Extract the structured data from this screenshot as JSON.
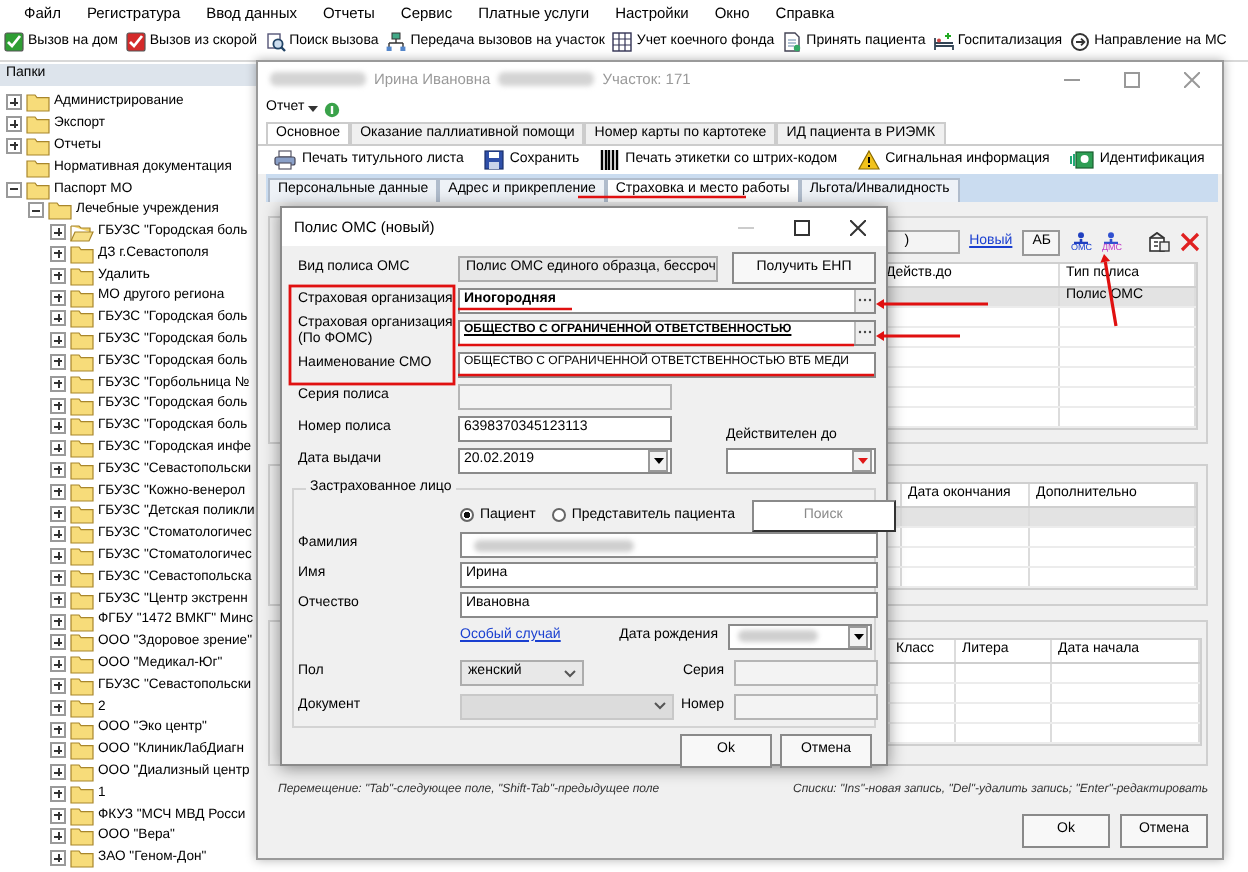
{
  "menu": [
    "Файл",
    "Регистратура",
    "Ввод данных",
    "Отчеты",
    "Сервис",
    "Платные услуги",
    "Настройки",
    "Окно",
    "Справка"
  ],
  "toolbar": [
    "Вызов на дом",
    "Вызов из скорой",
    "Поиск вызова",
    "Передача вызовов на участок",
    "Учет коечного фонда",
    "Принять пациента",
    "Госпитализация",
    "Направление на МС"
  ],
  "folders": {
    "title": "Папки",
    "tree": [
      {
        "label": "Администрирование",
        "expanded": false,
        "selected": false
      },
      {
        "label": "Экспорт",
        "expanded": false,
        "selected": false
      },
      {
        "label": "Отчеты",
        "expanded": false,
        "selected": false
      },
      {
        "label": "Нормативная документация",
        "selected": false
      },
      {
        "label": "Паспорт МО",
        "expanded": true,
        "selected": false,
        "children": [
          {
            "label": "Лечебные учреждения",
            "expanded": true,
            "selected": false,
            "children": [
              {
                "label": "ГБУЗС \"Городская боль",
                "expanded": false,
                "selected": true
              },
              {
                "label": "ДЗ г.Севастополя",
                "expanded": false,
                "selected": false
              },
              {
                "label": "Удалить",
                "expanded": false,
                "selected": false
              },
              {
                "label": "МО другого региона",
                "expanded": false,
                "selected": false
              },
              {
                "label": "ГБУЗС \"Городская боль",
                "expanded": false,
                "selected": false
              },
              {
                "label": "ГБУЗС \"Городская боль",
                "expanded": false,
                "selected": false
              },
              {
                "label": "ГБУЗС \"Городская боль",
                "expanded": false,
                "selected": false
              },
              {
                "label": "ГБУЗС \"Горбольница №",
                "expanded": false,
                "selected": false
              },
              {
                "label": "ГБУЗС \"Городская боль",
                "expanded": false,
                "selected": false
              },
              {
                "label": "ГБУЗС \"Городская боль",
                "expanded": false,
                "selected": false
              },
              {
                "label": "ГБУЗС \"Городская инфе",
                "expanded": false,
                "selected": false
              },
              {
                "label": "ГБУЗС \"Севастопольски",
                "expanded": false,
                "selected": false
              },
              {
                "label": "ГБУЗС \"Кожно-венерол",
                "expanded": false,
                "selected": false
              },
              {
                "label": "ГБУЗС \"Детская поликли",
                "expanded": false,
                "selected": false
              },
              {
                "label": "ГБУЗС \"Стоматологичес",
                "expanded": false,
                "selected": false
              },
              {
                "label": "ГБУЗС \"Стоматологичес",
                "expanded": false,
                "selected": false
              },
              {
                "label": "ГБУЗС \"Севастопольска",
                "expanded": false,
                "selected": false
              },
              {
                "label": "ГБУЗС \"Центр экстренн",
                "expanded": false,
                "selected": false
              },
              {
                "label": "ФГБУ \"1472 ВМКГ\" Минс",
                "expanded": false,
                "selected": false
              },
              {
                "label": "ООО \"Здоровое зрение\"",
                "expanded": false,
                "selected": false
              },
              {
                "label": "ООО \"Медикал-Юг\"",
                "expanded": false,
                "selected": false
              },
              {
                "label": "ГБУЗС \"Севастопольски",
                "expanded": false,
                "selected": false
              },
              {
                "label": "2",
                "expanded": false,
                "selected": false
              },
              {
                "label": "ООО \"Эко центр\"",
                "expanded": false,
                "selected": false
              },
              {
                "label": "ООО \"КлиникЛабДиагн",
                "expanded": false,
                "selected": false
              },
              {
                "label": "ООО \"Диализный центр",
                "expanded": false,
                "selected": false
              },
              {
                "label": "1",
                "expanded": false,
                "selected": false
              },
              {
                "label": "ФКУЗ \"МСЧ МВД Росси",
                "expanded": false,
                "selected": false
              },
              {
                "label": "ООО \"Вера\"",
                "expanded": false,
                "selected": false
              },
              {
                "label": "ЗАО \"Геном-Дон\"",
                "expanded": false,
                "selected": false
              }
            ]
          }
        ]
      }
    ]
  },
  "card_window": {
    "title_name": "Ирина Ивановна",
    "title_site": "Участок: 171",
    "report_menu": "Отчет",
    "tabs": [
      {
        "label": "Основное",
        "selected": true
      },
      {
        "label": "Оказание паллиативной помощи",
        "selected": false
      },
      {
        "label": "Номер карты по картотеке",
        "selected": false
      },
      {
        "label": "ИД пациента в РИЭМК",
        "selected": false
      }
    ],
    "toolbar": [
      "Печать титульного листа",
      "Сохранить",
      "Печать этикетки со штрих-кодом",
      "Сигнальная информация",
      "Идентификация"
    ],
    "subtabs": [
      {
        "label": "Персональные данные",
        "selected": false
      },
      {
        "label": "Адрес и прикрепление",
        "selected": false
      },
      {
        "label": "Страховка и место работы",
        "selected": true
      },
      {
        "label": "Льгота/Инвалидность",
        "selected": false
      }
    ],
    "policies": {
      "search_value": ")",
      "new_link": "Новый",
      "ab_button": "АБ",
      "add_buttons": [
        "ОМС",
        "ДМС"
      ],
      "columns": [
        "Действ.до",
        "Тип полиса"
      ],
      "rows": [
        {
          "type": "Полис ОМС",
          "selected": true
        }
      ]
    },
    "group_2": {
      "columns": [
        "Дата окончания",
        "Дополнительно"
      ],
      "rows": [
        {
          "selected": true
        }
      ]
    },
    "group_3": {
      "columns": [
        "Класс",
        "Литера",
        "Дата начала"
      ]
    },
    "hint_left": "Перемещение: \"Tab\"-следующее поле, \"Shift-Tab\"-предыдущее поле",
    "hint_right": "Списки: \"Ins\"-новая запись, \"Del\"-удалить запись; \"Enter\"-редактировать",
    "buttons": [
      "Ok",
      "Отмена"
    ]
  },
  "policy_dialog": {
    "title": "Полис ОМС (новый)",
    "policy_type": {
      "label": "Вид полиса ОМС",
      "value": "Полис ОМС единого образца, бессроч"
    },
    "get_enp_button": "Получить ЕНП",
    "insurer": {
      "label": "Страховая организация",
      "value": "Иногородняя"
    },
    "insurer_foms": {
      "label": "Страховая организация (По ФОМС)",
      "value": "ОБЩЕСТВО С ОГРАНИЧЕННОЙ ОТВЕТСТВЕННОСТЬЮ"
    },
    "smo_name": {
      "label": "Наименование СМО",
      "value": "ОБЩЕСТВО С ОГРАНИЧЕННОЙ ОТВЕТСТВЕННОСТЬЮ ВТБ МЕДИ"
    },
    "series": {
      "label": "Серия полиса"
    },
    "number": {
      "label": "Номер полиса",
      "value": "6398370345123113"
    },
    "valid_until": {
      "label": "Действителен до"
    },
    "issue_date": {
      "label": "Дата выдачи",
      "value": "20.02.2019"
    },
    "insured_person": {
      "title": "Застрахованное лицо",
      "radios": [
        {
          "label": "Пациент",
          "selected": true
        },
        {
          "label": "Представитель пациента",
          "selected": false
        }
      ],
      "search_button": {
        "label": "Поиск",
        "disabled": true
      },
      "surname": {
        "label": "Фамилия"
      },
      "name": {
        "label": "Имя",
        "value": "Ирина"
      },
      "patronymic": {
        "label": "Отчество",
        "value": "Ивановна"
      },
      "special_case_link": "Особый случай",
      "birth_date": {
        "label": "Дата рождения"
      },
      "sex": {
        "label": "Пол",
        "value": "женский"
      },
      "doc_series": {
        "label": "Серия"
      },
      "document": {
        "label": "Документ",
        "disabled": true
      },
      "doc_number": {
        "label": "Номер"
      }
    },
    "buttons": [
      "Ok",
      "Отмена"
    ]
  }
}
